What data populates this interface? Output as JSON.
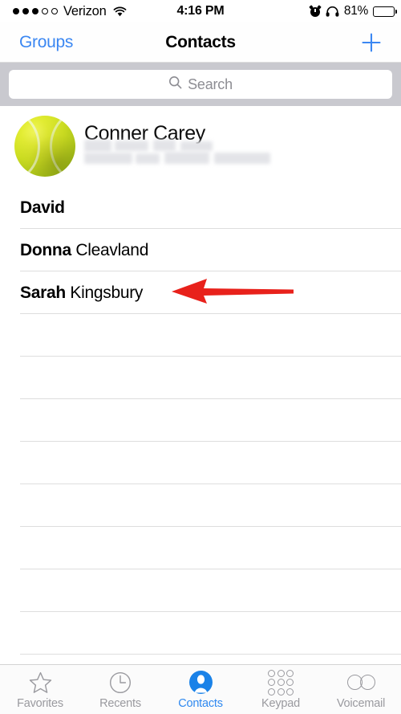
{
  "status_bar": {
    "signal_dots_filled": 3,
    "signal_dots_total": 5,
    "carrier": "Verizon",
    "wifi_icon": "wifi-icon",
    "time": "4:16 PM",
    "alarm_icon": "alarm-clock-icon",
    "headphones_icon": "headphones-icon",
    "battery_percent": "81%",
    "battery_icon": "battery-icon"
  },
  "nav_bar": {
    "back_label": "Groups",
    "title": "Contacts",
    "add_icon": "plus-icon"
  },
  "search": {
    "placeholder": "Search",
    "icon": "search-icon",
    "value": ""
  },
  "me_card": {
    "avatar_icon": "tennis-ball-avatar",
    "name": "Conner Carey",
    "redacted": true
  },
  "contacts": [
    {
      "first": "David",
      "last": ""
    },
    {
      "first": "Donna",
      "last": "Cleavland"
    },
    {
      "first": "Sarah",
      "last": "Kingsbury"
    }
  ],
  "empty_rows": 9,
  "annotation": {
    "type": "arrow",
    "direction": "left",
    "color": "#e8211b",
    "points_at": "Sarah Kingsbury"
  },
  "tab_bar": {
    "active": "Contacts",
    "tabs": [
      {
        "label": "Favorites",
        "icon": "star-icon"
      },
      {
        "label": "Recents",
        "icon": "clock-icon"
      },
      {
        "label": "Contacts",
        "icon": "person-circle-icon"
      },
      {
        "label": "Keypad",
        "icon": "keypad-grid-icon"
      },
      {
        "label": "Voicemail",
        "icon": "voicemail-icon"
      }
    ]
  },
  "colors": {
    "accent_blue": "#3b87f2",
    "tab_active_blue": "#2f89f0",
    "annotation_red": "#e8211b",
    "search_band": "#c9c9cf",
    "separator": "#dedede"
  }
}
